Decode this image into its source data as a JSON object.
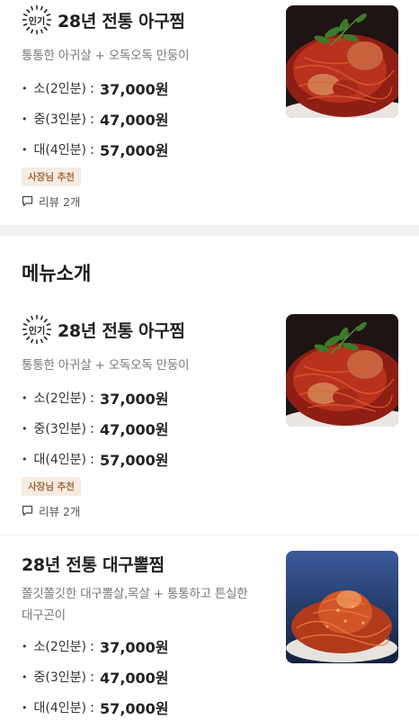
{
  "colors": {
    "tag_bg": "#f5ece3",
    "tag_text": "#a4683a",
    "gap": "#f2f2f2"
  },
  "menu_item_1": {
    "badge": "인기",
    "title": "28년 전통 아구찜",
    "description": "통통한 아귀살 + 오독오독 만둥이",
    "prices": [
      {
        "size": "소(2인분)",
        "amount": "37,000원"
      },
      {
        "size": "중(3인분)",
        "amount": "47,000원"
      },
      {
        "size": "대(4인분)",
        "amount": "57,000원"
      }
    ],
    "tag": "사장님 추천",
    "review": "리뷰 2개",
    "image_icon": "braised-monkfish-photo"
  },
  "section": {
    "title": "메뉴소개"
  },
  "menu_item_2": {
    "badge": "인기",
    "title": "28년 전통 아구찜",
    "description": "통통한 아귀살 + 오독오독 만둥이",
    "prices": [
      {
        "size": "소(2인분)",
        "amount": "37,000원"
      },
      {
        "size": "중(3인분)",
        "amount": "47,000원"
      },
      {
        "size": "대(4인분)",
        "amount": "57,000원"
      }
    ],
    "tag": "사장님 추천",
    "review": "리뷰 2개",
    "image_icon": "braised-monkfish-photo"
  },
  "menu_item_3": {
    "title": "28년 전통 대구뽈찜",
    "description_line1": "쫄깃쫄깃한 대구뽈살,목살 + 통통하고 튼실한",
    "description_line2": "대구곤이",
    "prices": [
      {
        "size": "소(2인분)",
        "amount": "37,000원"
      },
      {
        "size": "중(3인분)",
        "amount": "47,000원"
      },
      {
        "size": "대(4인분)",
        "amount": "57,000원"
      }
    ],
    "image_icon": "braised-cod-cheek-photo"
  }
}
